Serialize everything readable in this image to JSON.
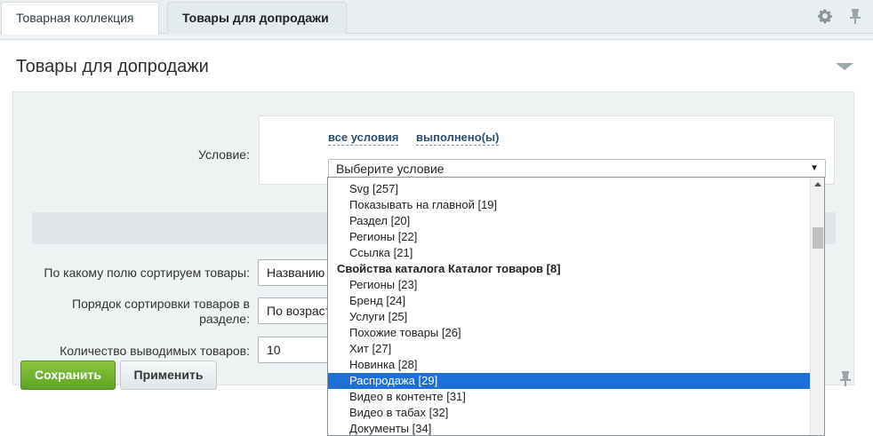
{
  "tabs": [
    {
      "label": "Товарная коллекция"
    },
    {
      "label": "Товары для допродажи"
    }
  ],
  "panel": {
    "title": "Товары для допродажи"
  },
  "form": {
    "condition_label": "Условие:",
    "link_all": "все условия",
    "link_done": "выполнено(ы)",
    "condition_select": "Выберите условие",
    "sort_field_label": "По какому полю сортируем товары:",
    "sort_field_value": "Названию",
    "sort_order_label_line1": "Порядок сортировки товаров в",
    "sort_order_label_line2": "разделе:",
    "sort_order_value": "По возраст",
    "count_label": "Количество выводимых товаров:",
    "count_value": "10"
  },
  "buttons": {
    "save": "Сохранить",
    "apply": "Применить"
  },
  "dropdown": {
    "items": [
      {
        "label": "Svg [257]",
        "type": "item"
      },
      {
        "label": "Показывать на главной [19]",
        "type": "item"
      },
      {
        "label": "Раздел [20]",
        "type": "item"
      },
      {
        "label": "Регионы [22]",
        "type": "item"
      },
      {
        "label": "Ссылка [21]",
        "type": "item"
      },
      {
        "label": "Свойства каталога Каталог товаров [8]",
        "type": "group"
      },
      {
        "label": "Регионы [23]",
        "type": "item"
      },
      {
        "label": "Бренд [24]",
        "type": "item"
      },
      {
        "label": "Услуги [25]",
        "type": "item"
      },
      {
        "label": "Похожие товары [26]",
        "type": "item"
      },
      {
        "label": "Хит [27]",
        "type": "item"
      },
      {
        "label": "Новинка [28]",
        "type": "item"
      },
      {
        "label": "Распродажа [29]",
        "type": "selected"
      },
      {
        "label": "Видео в контенте [31]",
        "type": "item"
      },
      {
        "label": "Видео в табах [32]",
        "type": "item"
      },
      {
        "label": "Документы [34]",
        "type": "item"
      }
    ]
  },
  "colors": {
    "selected_bg": "#1e70d6",
    "save_button": "#6cb02f",
    "link": "#2b4e74"
  }
}
